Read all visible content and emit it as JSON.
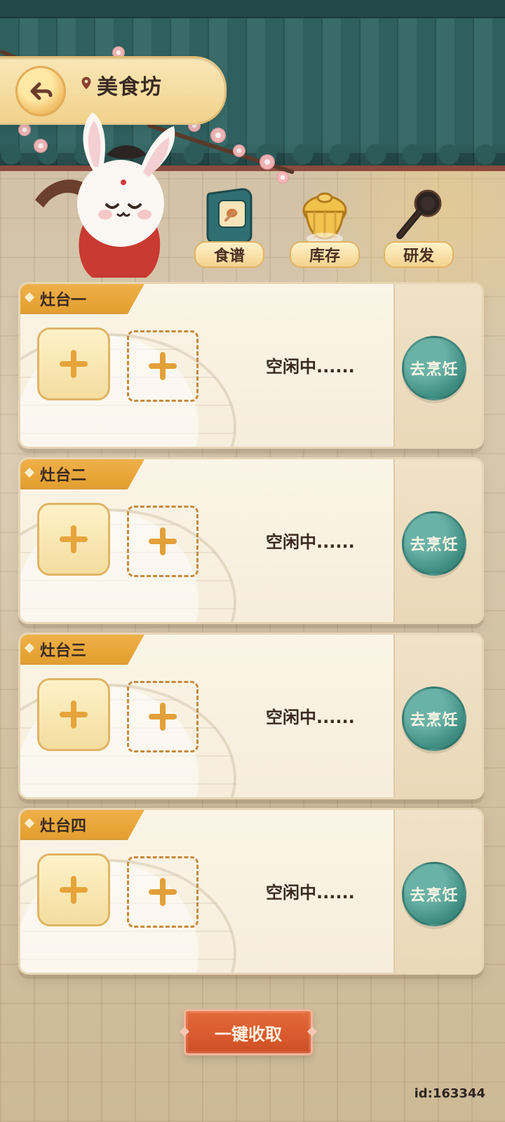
{
  "header": {
    "title": "美食坊",
    "back_icon": "back-arrow-icon",
    "location_icon": "location-pin-icon"
  },
  "toolbar": {
    "items": [
      {
        "label": "食谱",
        "icon": "recipe-book-icon"
      },
      {
        "label": "库存",
        "icon": "storage-hut-icon"
      },
      {
        "label": "研发",
        "icon": "research-ladle-icon"
      }
    ]
  },
  "stoves": [
    {
      "label": "灶台一",
      "status": "空闲中......",
      "action_label": "去烹饪"
    },
    {
      "label": "灶台二",
      "status": "空闲中......",
      "action_label": "去烹饪"
    },
    {
      "label": "灶台三",
      "status": "空闲中......",
      "action_label": "去烹饪"
    },
    {
      "label": "灶台四",
      "status": "空闲中......",
      "action_label": "去烹饪"
    }
  ],
  "footer": {
    "collect_label": "一键收取",
    "user_id": "id:163344"
  },
  "colors": {
    "accent_orange": "#e39f2f",
    "cook_green": "#3f8e82",
    "collect_red": "#cf4e25"
  }
}
